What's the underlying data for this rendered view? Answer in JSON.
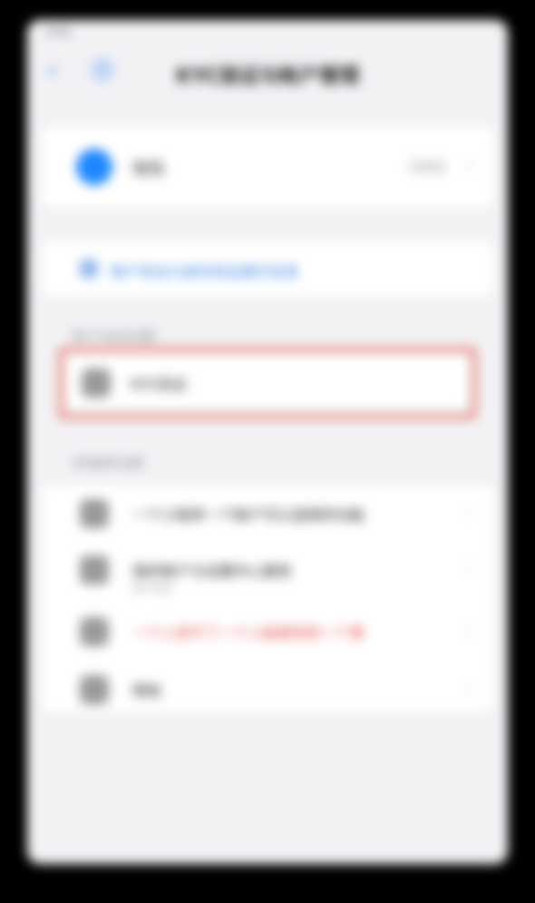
{
  "status": {
    "time": "9:41",
    "carrier": "",
    "battery": ""
  },
  "nav": {
    "back_label": "‹",
    "title": "KYC验证与帐户管理"
  },
  "account": {
    "name": "钱包",
    "action": "已验证"
  },
  "link": {
    "text": "账户安全与身份验证提示信息"
  },
  "section_one": {
    "label": "账户与安全设置"
  },
  "highlighted": {
    "label": "KYC验证"
  },
  "section_two": {
    "label": "其他服务设置"
  },
  "items": [
    {
      "label": "一个小程序一个账户可以选择的功能",
      "sub": ""
    },
    {
      "label": "我的账户与设置中心服务",
      "sub": "账户信息"
    },
    {
      "label": "一个人来不了一个人能做到的一个事",
      "sub": "",
      "danger": true
    },
    {
      "label": "帮助"
    }
  ],
  "colors": {
    "accent": "#2a7de1",
    "danger": "#e2483d",
    "highlight": "#e88a7c",
    "avatar": "#1e88ff"
  }
}
